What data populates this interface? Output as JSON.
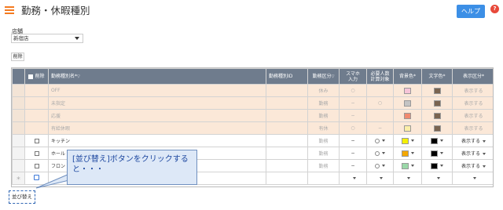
{
  "header": {
    "title": "勤務・休暇種別",
    "help_label": "ヘルプ",
    "help_icon_text": "?"
  },
  "store": {
    "label": "店舗",
    "value": "新宿店"
  },
  "toolbar": {
    "delete_label": "削除"
  },
  "table": {
    "headers": {
      "delete": "削除",
      "name": "勤務種別名",
      "id": "勤務種別ID",
      "kubun": "勤務区分",
      "smaho_1": "スマホ",
      "smaho_2": "入力",
      "req_1": "必要人数",
      "req_2": "計算対象",
      "bg": "背景色",
      "fg": "文字色",
      "disp": "表示区分"
    },
    "system_rows": [
      {
        "name": "OFF",
        "kubun": "休み",
        "smaho": "○",
        "req": "",
        "bg": "#f6c4d8",
        "fg": "#7a6450",
        "disp": "表示する"
      },
      {
        "name": "未指定",
        "kubun": "勤務",
        "smaho": "−",
        "req": "○",
        "bg": "#c4c4c4",
        "fg": "#7a6450",
        "disp": "表示する"
      },
      {
        "name": "応援",
        "kubun": "勤務",
        "smaho": "−",
        "req": "",
        "bg": "#f08a70",
        "fg": "#7a6450",
        "disp": "表示する"
      },
      {
        "name": "有給休暇",
        "kubun": "有休",
        "smaho": "○",
        "req": "−",
        "bg": "#fbeea8",
        "fg": "#7a6450",
        "disp": "表示する"
      }
    ],
    "user_rows": [
      {
        "name": "キッチン",
        "kubun": "勤務",
        "smaho": "−",
        "bg": "#f4f000",
        "fg": "#000000",
        "disp": "表示する"
      },
      {
        "name": "ホール",
        "kubun": "勤務",
        "smaho": "−",
        "bg": "#f4a800",
        "fg": "#000000",
        "disp": "表示する"
      },
      {
        "name": "フロン",
        "kubun": "勤務",
        "smaho": "−",
        "bg": "#9ad8a8",
        "fg": "#000000",
        "disp": "表示する"
      }
    ],
    "new_row_marker": "＊"
  },
  "callout": {
    "text": "[並び替え]ボタンをクリックすると・・・"
  },
  "sort_button": {
    "label": "並び替え"
  },
  "colors": {
    "accent": "#f47a20",
    "header_bg": "#6f7c8d",
    "help_bg": "#3c8fe6",
    "system_row_bg": "#fbe8d8"
  }
}
